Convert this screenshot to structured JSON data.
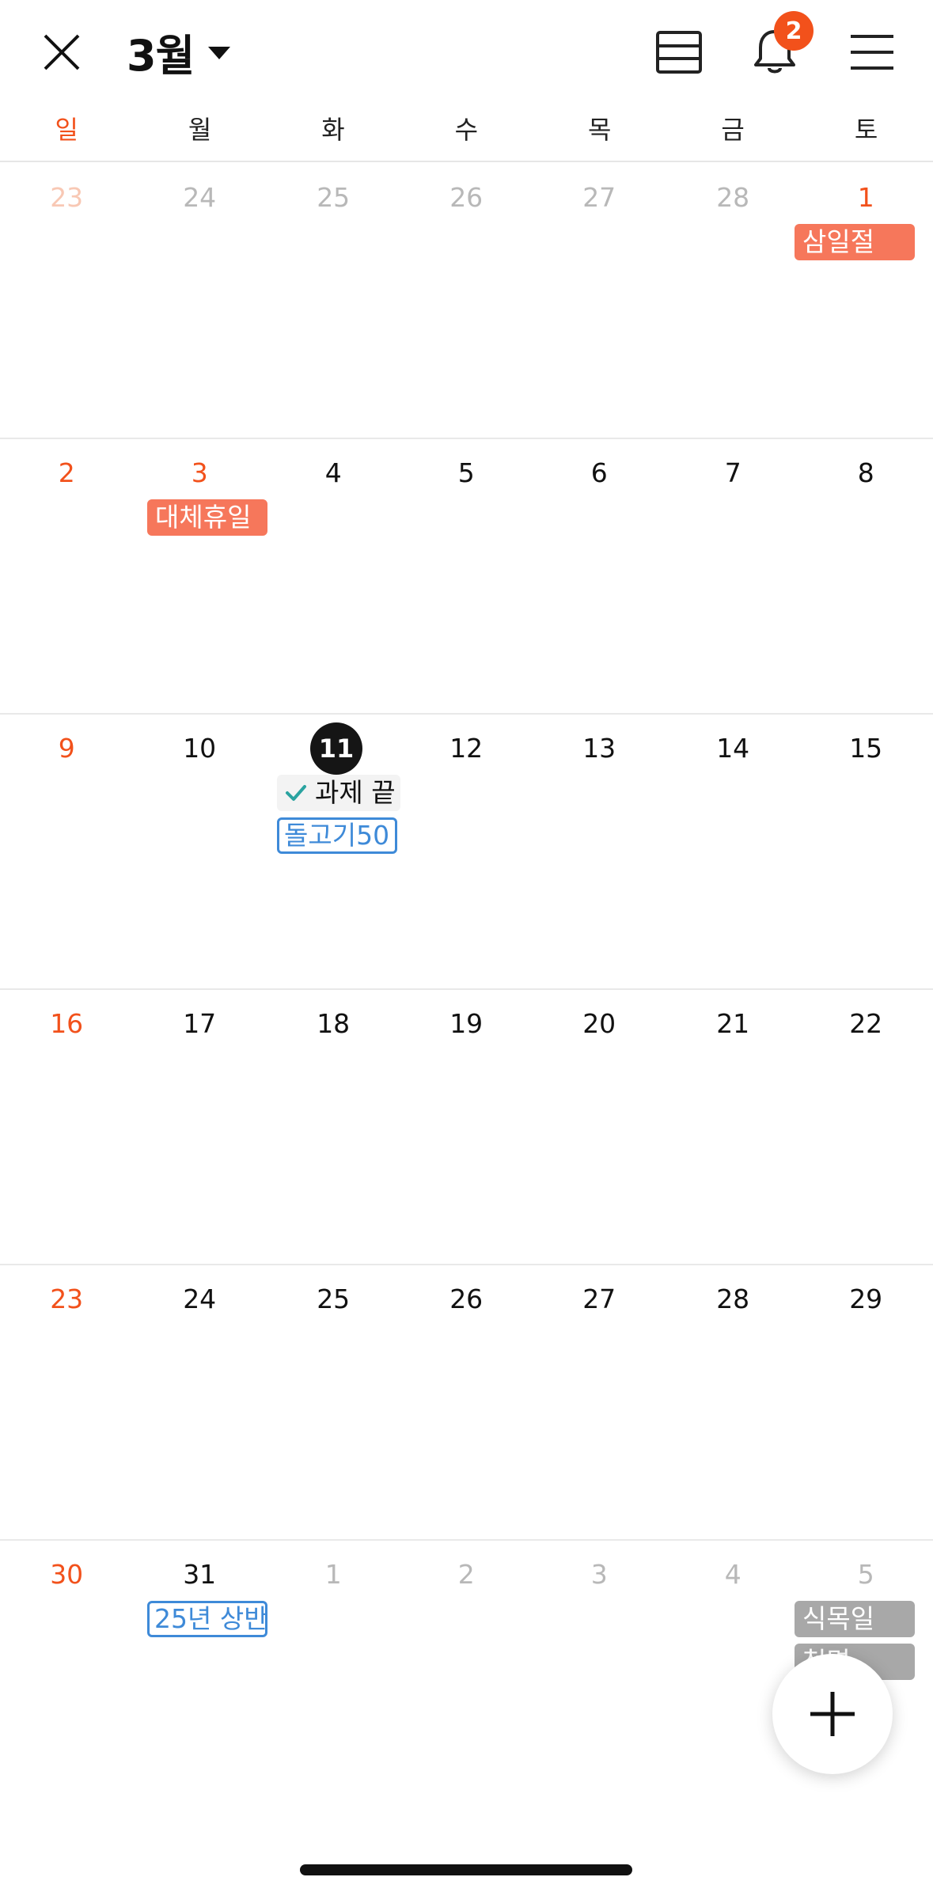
{
  "header": {
    "month_label": "3월",
    "notification_count": "2",
    "icons": [
      "close-icon",
      "chevron-down-icon",
      "list-view-icon",
      "bell-icon",
      "hamburger-menu-icon"
    ]
  },
  "weekdays": [
    "일",
    "월",
    "화",
    "수",
    "목",
    "금",
    "토"
  ],
  "weeks": [
    [
      "23",
      "24",
      "25",
      "26",
      "27",
      "28",
      "1"
    ],
    [
      "2",
      "3",
      "4",
      "5",
      "6",
      "7",
      "8"
    ],
    [
      "9",
      "10",
      "11",
      "12",
      "13",
      "14",
      "15"
    ],
    [
      "16",
      "17",
      "18",
      "19",
      "20",
      "21",
      "22"
    ],
    [
      "23",
      "24",
      "25",
      "26",
      "27",
      "28",
      "29"
    ],
    [
      "30",
      "31",
      "1",
      "2",
      "3",
      "4",
      "5"
    ]
  ],
  "events": {
    "samiljeol": "삼일절",
    "substitute_holiday": "대체휴일",
    "task_done": "과제 끝",
    "dolgogi": "돌고기50",
    "first_half_25": "25년 상반",
    "arbor_day": "식목일",
    "cheongmyeong": "청명"
  },
  "colors": {
    "sunday": "#f2511b",
    "holiday_bg": "#f6775b",
    "outline_event": "#3e8ad8",
    "today_bg": "#151515",
    "badge": "#f2511b",
    "gray_event": "#a8a8a8"
  }
}
